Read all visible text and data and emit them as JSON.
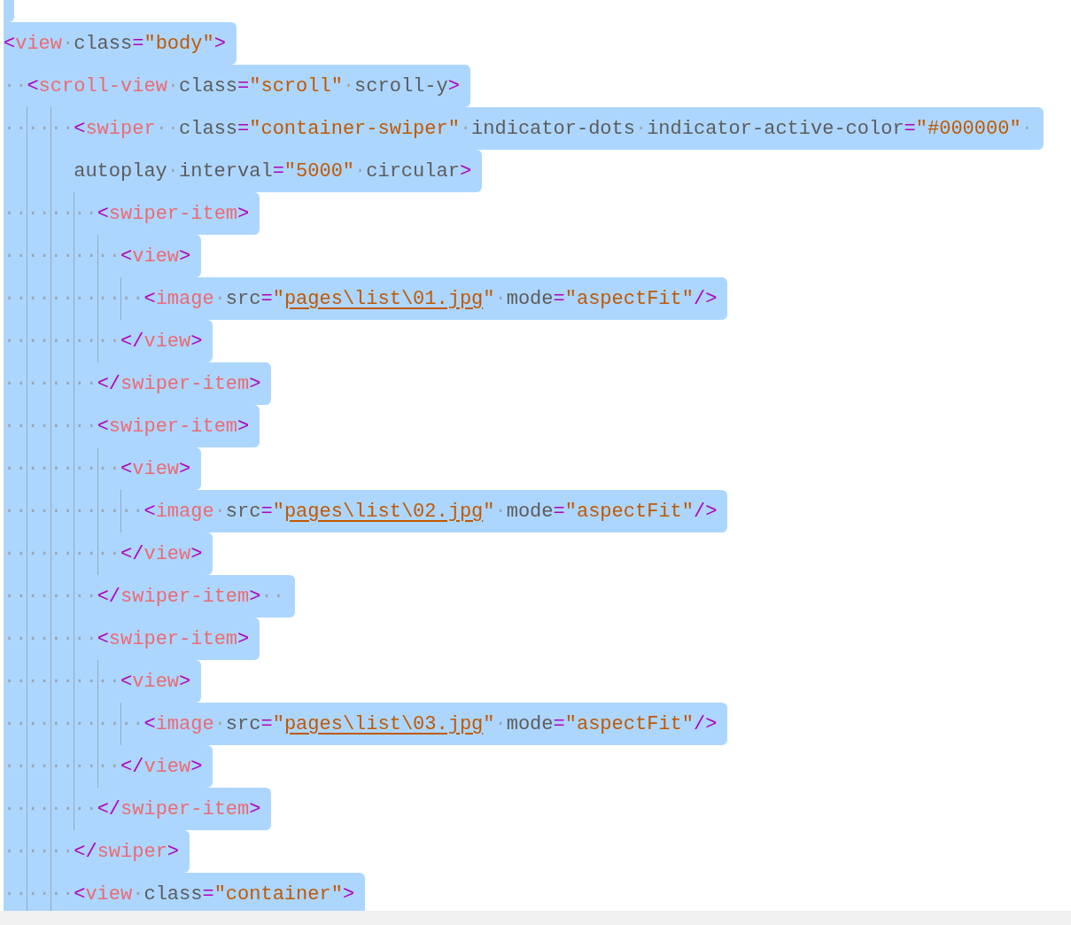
{
  "editor": {
    "lines": [
      {
        "selected": true
      },
      {
        "selected": true,
        "tokens": [
          {
            "kind": "p",
            "t": "<"
          },
          {
            "kind": "tag",
            "t": "view"
          },
          {
            "kind": "ws",
            "t": "·"
          },
          {
            "kind": "attr",
            "t": "class"
          },
          {
            "kind": "p",
            "t": "="
          },
          {
            "kind": "str",
            "t": "\"body\""
          },
          {
            "kind": "p",
            "t": ">"
          }
        ]
      },
      {
        "selected": true,
        "tokens": [
          {
            "kind": "ws",
            "t": "··"
          },
          {
            "kind": "p",
            "t": "<"
          },
          {
            "kind": "tag",
            "t": "scroll-view"
          },
          {
            "kind": "ws",
            "t": "·"
          },
          {
            "kind": "attr",
            "t": "class"
          },
          {
            "kind": "p",
            "t": "="
          },
          {
            "kind": "str",
            "t": "\"scroll\""
          },
          {
            "kind": "ws",
            "t": "·"
          },
          {
            "kind": "attr",
            "t": "scroll-y"
          },
          {
            "kind": "p",
            "t": ">"
          }
        ]
      },
      {
        "selected": true,
        "tokens": [
          {
            "kind": "ws",
            "t": "······"
          },
          {
            "kind": "p",
            "t": "<"
          },
          {
            "kind": "tag",
            "t": "swiper"
          },
          {
            "kind": "ws",
            "t": "··"
          },
          {
            "kind": "attr",
            "t": "class"
          },
          {
            "kind": "p",
            "t": "="
          },
          {
            "kind": "str",
            "t": "\"container-swiper\""
          },
          {
            "kind": "ws",
            "t": "·"
          },
          {
            "kind": "attr",
            "t": "indicator-dots"
          },
          {
            "kind": "ws",
            "t": "·"
          },
          {
            "kind": "attr",
            "t": "indicator-active-color"
          },
          {
            "kind": "p",
            "t": "="
          },
          {
            "kind": "str",
            "t": "\"#000000\""
          },
          {
            "kind": "ws",
            "t": "·"
          }
        ]
      },
      {
        "selected": true,
        "wrapped": true,
        "tokens": [
          {
            "kind": "attr",
            "t": "autoplay"
          },
          {
            "kind": "ws",
            "t": "·"
          },
          {
            "kind": "attr",
            "t": "interval"
          },
          {
            "kind": "p",
            "t": "="
          },
          {
            "kind": "str",
            "t": "\"5000\""
          },
          {
            "kind": "ws",
            "t": "·"
          },
          {
            "kind": "attr",
            "t": "circular"
          },
          {
            "kind": "p",
            "t": ">"
          }
        ]
      },
      {
        "selected": true,
        "tokens": [
          {
            "kind": "ws",
            "t": "········"
          },
          {
            "kind": "p",
            "t": "<"
          },
          {
            "kind": "tag",
            "t": "swiper-item"
          },
          {
            "kind": "p",
            "t": ">"
          }
        ]
      },
      {
        "selected": true,
        "tokens": [
          {
            "kind": "ws",
            "t": "··········"
          },
          {
            "kind": "p",
            "t": "<"
          },
          {
            "kind": "tag",
            "t": "view"
          },
          {
            "kind": "p",
            "t": ">"
          }
        ]
      },
      {
        "selected": true,
        "tokens": [
          {
            "kind": "ws",
            "t": "············"
          },
          {
            "kind": "p",
            "t": "<"
          },
          {
            "kind": "tag",
            "t": "image"
          },
          {
            "kind": "ws",
            "t": "·"
          },
          {
            "kind": "attr",
            "t": "src"
          },
          {
            "kind": "p",
            "t": "="
          },
          {
            "kind": "str",
            "t": "\""
          },
          {
            "kind": "link",
            "t": "pages\\list\\01.jpg"
          },
          {
            "kind": "str",
            "t": "\""
          },
          {
            "kind": "ws",
            "t": "·"
          },
          {
            "kind": "attr",
            "t": "mode"
          },
          {
            "kind": "p",
            "t": "="
          },
          {
            "kind": "str",
            "t": "\"aspectFit\""
          },
          {
            "kind": "p",
            "t": "/>"
          }
        ]
      },
      {
        "selected": true,
        "tokens": [
          {
            "kind": "ws",
            "t": "··········"
          },
          {
            "kind": "p",
            "t": "</"
          },
          {
            "kind": "tag",
            "t": "view"
          },
          {
            "kind": "p",
            "t": ">"
          }
        ]
      },
      {
        "selected": true,
        "tokens": [
          {
            "kind": "ws",
            "t": "········"
          },
          {
            "kind": "p",
            "t": "</"
          },
          {
            "kind": "tag",
            "t": "swiper-item"
          },
          {
            "kind": "p",
            "t": ">"
          }
        ]
      },
      {
        "selected": true,
        "tokens": [
          {
            "kind": "ws",
            "t": "········"
          },
          {
            "kind": "p",
            "t": "<"
          },
          {
            "kind": "tag",
            "t": "swiper-item"
          },
          {
            "kind": "p",
            "t": ">"
          }
        ]
      },
      {
        "selected": true,
        "tokens": [
          {
            "kind": "ws",
            "t": "··········"
          },
          {
            "kind": "p",
            "t": "<"
          },
          {
            "kind": "tag",
            "t": "view"
          },
          {
            "kind": "p",
            "t": ">"
          }
        ]
      },
      {
        "selected": true,
        "tokens": [
          {
            "kind": "ws",
            "t": "············"
          },
          {
            "kind": "p",
            "t": "<"
          },
          {
            "kind": "tag",
            "t": "image"
          },
          {
            "kind": "ws",
            "t": "·"
          },
          {
            "kind": "attr",
            "t": "src"
          },
          {
            "kind": "p",
            "t": "="
          },
          {
            "kind": "str",
            "t": "\""
          },
          {
            "kind": "link",
            "t": "pages\\list\\02.jpg"
          },
          {
            "kind": "str",
            "t": "\""
          },
          {
            "kind": "ws",
            "t": "·"
          },
          {
            "kind": "attr",
            "t": "mode"
          },
          {
            "kind": "p",
            "t": "="
          },
          {
            "kind": "str",
            "t": "\"aspectFit\""
          },
          {
            "kind": "p",
            "t": "/>"
          }
        ]
      },
      {
        "selected": true,
        "tokens": [
          {
            "kind": "ws",
            "t": "··········"
          },
          {
            "kind": "p",
            "t": "</"
          },
          {
            "kind": "tag",
            "t": "view"
          },
          {
            "kind": "p",
            "t": ">"
          }
        ]
      },
      {
        "selected": true,
        "tokens": [
          {
            "kind": "ws",
            "t": "········"
          },
          {
            "kind": "p",
            "t": "</"
          },
          {
            "kind": "tag",
            "t": "swiper-item"
          },
          {
            "kind": "p",
            "t": ">"
          },
          {
            "kind": "ws",
            "t": "··"
          }
        ]
      },
      {
        "selected": true,
        "tokens": [
          {
            "kind": "ws",
            "t": "········"
          },
          {
            "kind": "p",
            "t": "<"
          },
          {
            "kind": "tag",
            "t": "swiper-item"
          },
          {
            "kind": "p",
            "t": ">"
          }
        ]
      },
      {
        "selected": true,
        "tokens": [
          {
            "kind": "ws",
            "t": "··········"
          },
          {
            "kind": "p",
            "t": "<"
          },
          {
            "kind": "tag",
            "t": "view"
          },
          {
            "kind": "p",
            "t": ">"
          }
        ]
      },
      {
        "selected": true,
        "tokens": [
          {
            "kind": "ws",
            "t": "············"
          },
          {
            "kind": "p",
            "t": "<"
          },
          {
            "kind": "tag",
            "t": "image"
          },
          {
            "kind": "ws",
            "t": "·"
          },
          {
            "kind": "attr",
            "t": "src"
          },
          {
            "kind": "p",
            "t": "="
          },
          {
            "kind": "str",
            "t": "\""
          },
          {
            "kind": "link",
            "t": "pages\\list\\03.jpg"
          },
          {
            "kind": "str",
            "t": "\""
          },
          {
            "kind": "ws",
            "t": "·"
          },
          {
            "kind": "attr",
            "t": "mode"
          },
          {
            "kind": "p",
            "t": "="
          },
          {
            "kind": "str",
            "t": "\"aspectFit\""
          },
          {
            "kind": "p",
            "t": "/>"
          }
        ]
      },
      {
        "selected": true,
        "tokens": [
          {
            "kind": "ws",
            "t": "··········"
          },
          {
            "kind": "p",
            "t": "</"
          },
          {
            "kind": "tag",
            "t": "view"
          },
          {
            "kind": "p",
            "t": ">"
          }
        ]
      },
      {
        "selected": true,
        "tokens": [
          {
            "kind": "ws",
            "t": "········"
          },
          {
            "kind": "p",
            "t": "</"
          },
          {
            "kind": "tag",
            "t": "swiper-item"
          },
          {
            "kind": "p",
            "t": ">"
          }
        ]
      },
      {
        "selected": true,
        "tokens": [
          {
            "kind": "ws",
            "t": "······"
          },
          {
            "kind": "p",
            "t": "</"
          },
          {
            "kind": "tag",
            "t": "swiper"
          },
          {
            "kind": "p",
            "t": ">"
          }
        ]
      },
      {
        "selected": true,
        "tokens": [
          {
            "kind": "ws",
            "t": "······"
          },
          {
            "kind": "p",
            "t": "<"
          },
          {
            "kind": "tag",
            "t": "view"
          },
          {
            "kind": "ws",
            "t": "·"
          },
          {
            "kind": "attr",
            "t": "class"
          },
          {
            "kind": "p",
            "t": "="
          },
          {
            "kind": "str",
            "t": "\"container\""
          },
          {
            "kind": "p",
            "t": ">"
          }
        ]
      }
    ]
  }
}
